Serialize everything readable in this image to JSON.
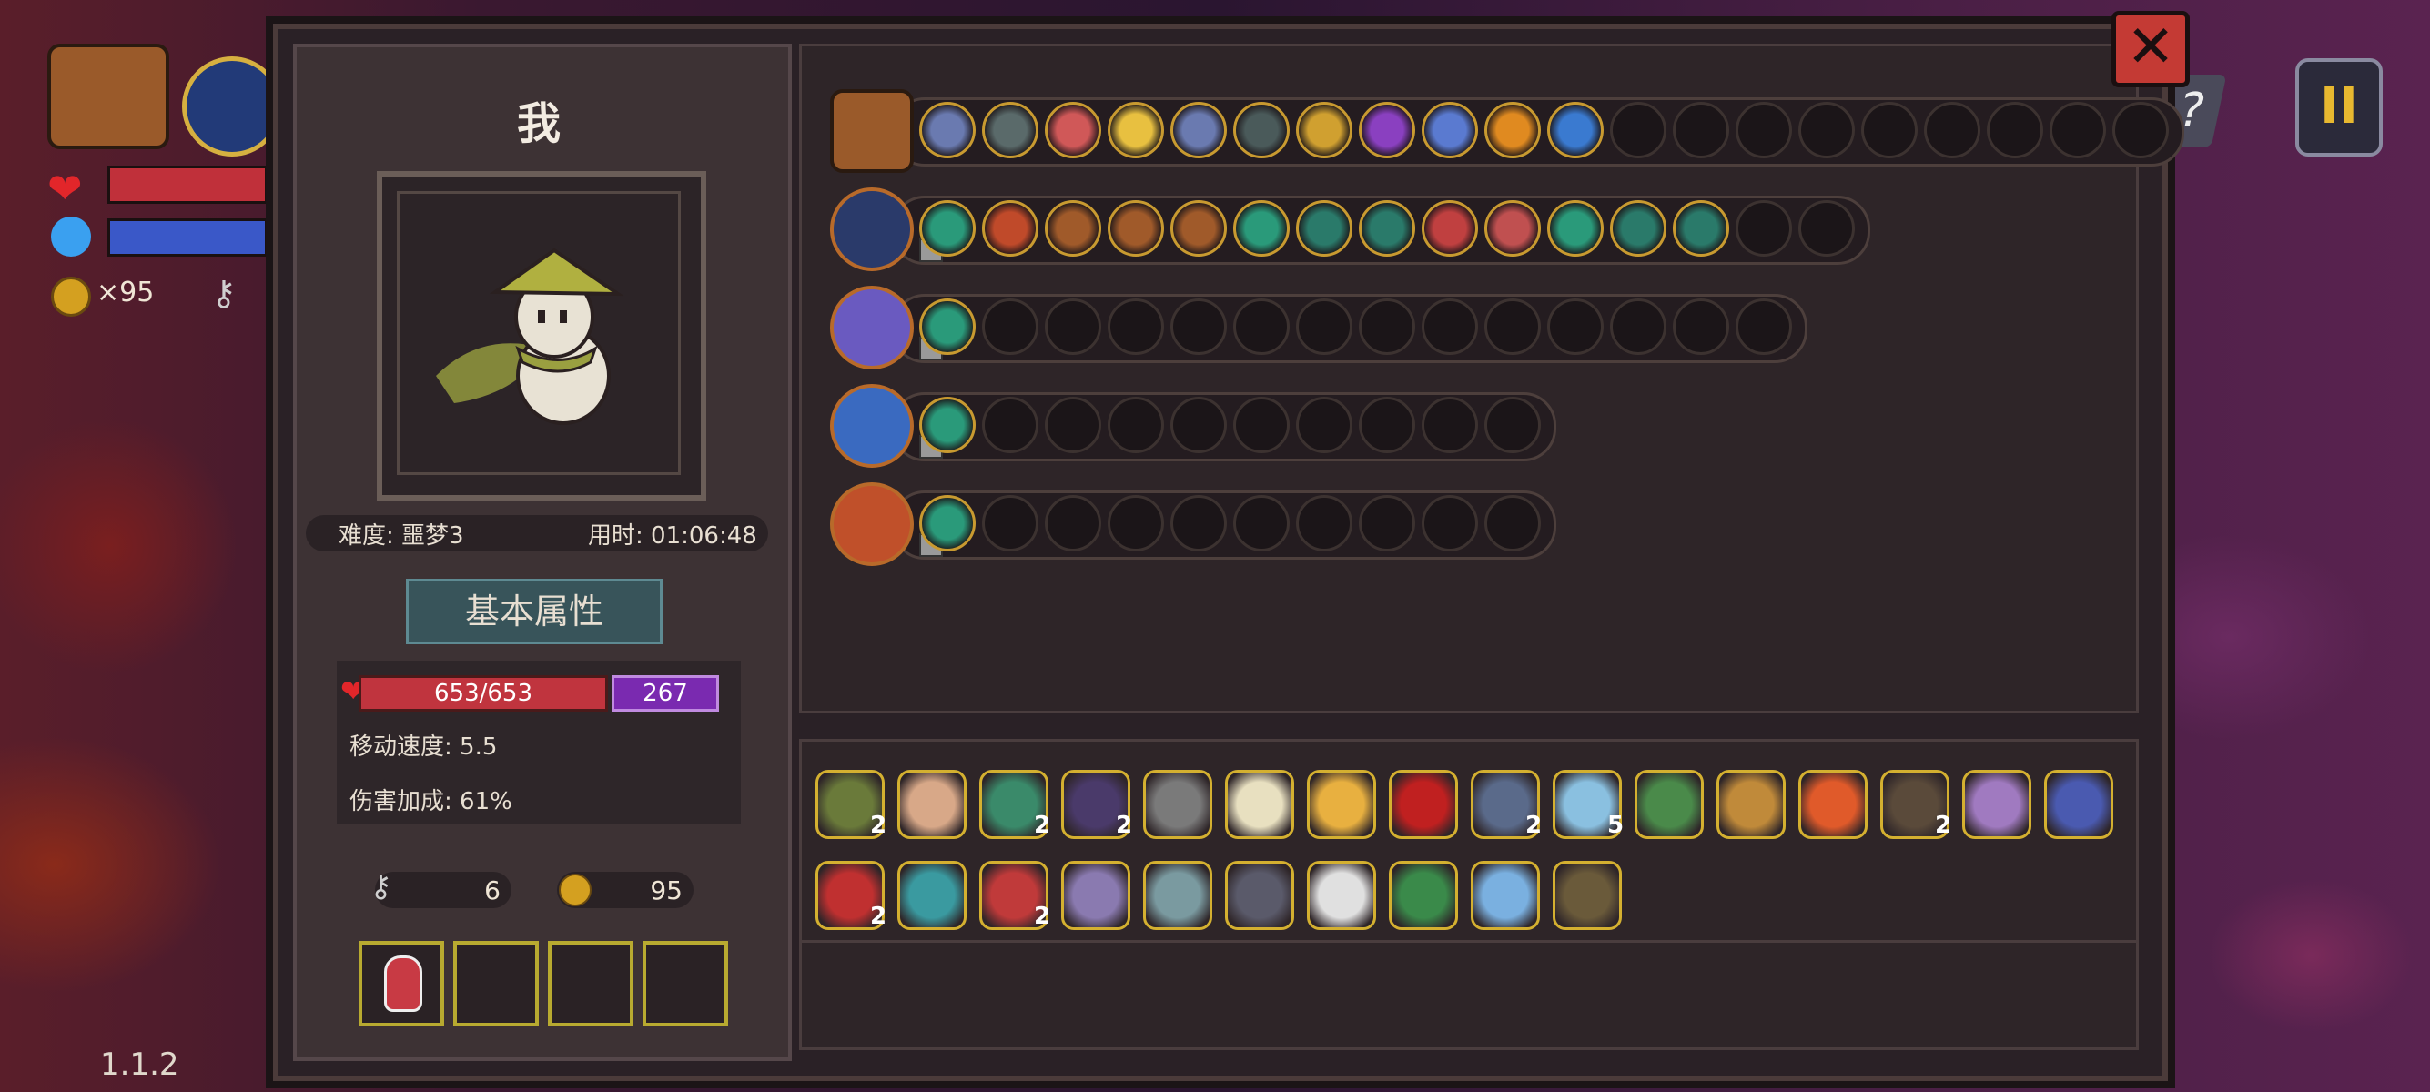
{
  "hud": {
    "coins": "×95",
    "version": "1.1.2",
    "help": "?",
    "pause": "II"
  },
  "panel": {
    "close": "✕",
    "player_name": "我",
    "difficulty": "难度: 噩梦3",
    "time": "用时: 01:06:48",
    "tab": "基本属性",
    "hp": "653/653",
    "shield": "267",
    "move_speed": "移动速度: 5.5",
    "damage_bonus": "伤害加成: 61%",
    "keys": "6",
    "gold": "95"
  },
  "weapons": [
    {
      "name": "bag",
      "weapon_color": "#9a5a2a",
      "slots": [
        "#6a7ab0",
        "#5a6a6a",
        "#d05858",
        "#e8c040",
        "#6a7ab0",
        "#4a5a5a",
        "#d0a030",
        "#8a40c0",
        "#5a7ad0",
        "#e08a20",
        "#3a7ad0",
        "empty",
        "empty",
        "empty",
        "empty",
        "empty",
        "empty",
        "empty",
        "empty",
        "empty"
      ]
    },
    {
      "name": "spellbook",
      "weapon_color": "#2a3a6a",
      "slots": [
        "#2a9a7a",
        "#c04a2a",
        "#a05a2a",
        "#a05a2a",
        "#a05a2a",
        "#2a9a7a",
        "#2a7a6a",
        "#2a7a6a",
        "#c04040",
        "#c05050",
        "#2a9a7a",
        "#2a7a6a",
        "#2a7a6a",
        "empty",
        "empty"
      ]
    },
    {
      "name": "staff",
      "weapon_color": "#6a5ac0",
      "slots": [
        "#2a9a7a",
        "empty",
        "empty",
        "empty",
        "empty",
        "empty",
        "empty",
        "empty",
        "empty",
        "empty",
        "empty",
        "empty",
        "empty",
        "empty"
      ]
    },
    {
      "name": "dagger",
      "weapon_color": "#3a6ac0",
      "slots": [
        "#2a9a7a",
        "empty",
        "empty",
        "empty",
        "empty",
        "empty",
        "empty",
        "empty",
        "empty",
        "empty"
      ]
    },
    {
      "name": "torch",
      "weapon_color": "#c0502a",
      "slots": [
        "#2a9a7a",
        "empty",
        "empty",
        "empty",
        "empty",
        "empty",
        "empty",
        "empty",
        "empty",
        "empty"
      ]
    }
  ],
  "items": [
    {
      "name": "hat-relic",
      "color": "#6a7a3a",
      "count": "2"
    },
    {
      "name": "pet-relic",
      "color": "#d8a888",
      "count": ""
    },
    {
      "name": "cloth-relic",
      "color": "#3a8a6a",
      "count": "2"
    },
    {
      "name": "cloak-relic",
      "color": "#4a3a6a",
      "count": "2"
    },
    {
      "name": "bone-relic",
      "color": "#7a7a7a",
      "count": ""
    },
    {
      "name": "wing-relic",
      "color": "#e8e0c0",
      "count": ""
    },
    {
      "name": "candy-relic",
      "color": "#e8b040",
      "count": ""
    },
    {
      "name": "eye-relic",
      "color": "#c02020",
      "count": ""
    },
    {
      "name": "stone-relic",
      "color": "#5a6a8a",
      "count": "2"
    },
    {
      "name": "shell-relic",
      "color": "#8ac0e0",
      "count": "5"
    },
    {
      "name": "helmet-relic",
      "color": "#4a8a4a",
      "count": ""
    },
    {
      "name": "pickaxe-relic",
      "color": "#c08a3a",
      "count": ""
    },
    {
      "name": "heart-relic",
      "color": "#e05a2a",
      "count": ""
    },
    {
      "name": "robe-relic",
      "color": "#5a4a3a",
      "count": "2"
    },
    {
      "name": "gem-relic",
      "color": "#a07ac0",
      "count": ""
    },
    {
      "name": "totem-relic",
      "color": "#4a5ab0",
      "count": ""
    },
    {
      "name": "eyeball-relic",
      "color": "#c03030",
      "count": "2"
    },
    {
      "name": "dice-relic",
      "color": "#3a9aa0",
      "count": ""
    },
    {
      "name": "demon-relic",
      "color": "#c03a3a",
      "count": "2"
    },
    {
      "name": "boot-relic",
      "color": "#8a7ab0",
      "count": ""
    },
    {
      "name": "sword-relic",
      "color": "#7a9aa0",
      "count": ""
    },
    {
      "name": "armor-relic",
      "color": "#5a5a6a",
      "count": ""
    },
    {
      "name": "teeth-relic",
      "color": "#e0e0e0",
      "count": ""
    },
    {
      "name": "leaf-relic",
      "color": "#3a8a4a",
      "count": ""
    },
    {
      "name": "lens-relic",
      "color": "#7ab0e0",
      "count": ""
    },
    {
      "name": "worm-relic",
      "color": "#6a5a3a",
      "count": ""
    }
  ]
}
